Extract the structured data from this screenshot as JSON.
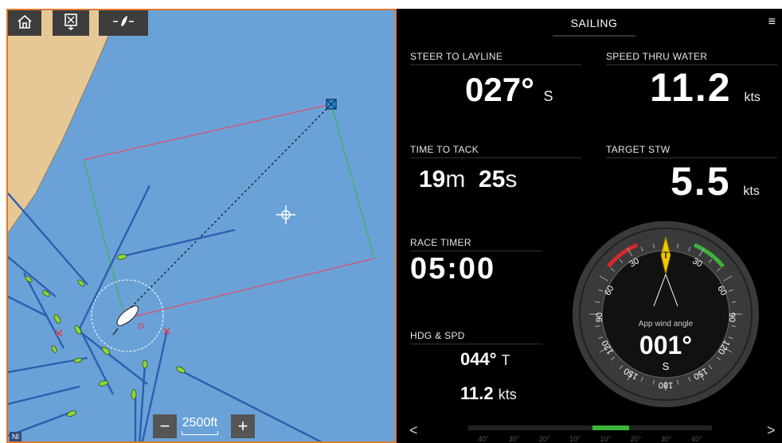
{
  "chart": {
    "scale_label": "2500ft",
    "zoom_out": "−",
    "zoom_in": "+",
    "logo": "NI"
  },
  "header": {
    "title": "SAILING"
  },
  "tiles": {
    "steer_to_layline": {
      "label": "STEER TO LAYLINE",
      "value": "027°",
      "unit": "S"
    },
    "speed_thru_water": {
      "label": "SPEED THRU WATER",
      "value": "11.2",
      "unit": "kts"
    },
    "time_to_tack": {
      "label": "TIME TO TACK",
      "minutes": "19",
      "m_unit": "m",
      "seconds": "25",
      "s_unit": "s"
    },
    "target_stw": {
      "label": "TARGET STW",
      "value": "5.5",
      "unit": "kts"
    },
    "race_timer": {
      "label": "RACE TIMER",
      "value": "05:00"
    },
    "hdg_spd": {
      "label": "HDG & SPD",
      "heading": "044°",
      "heading_unit": "T",
      "speed": "11.2",
      "speed_unit": "kts"
    }
  },
  "wind_gauge": {
    "label": "App wind angle",
    "value": "001°",
    "unit": "S",
    "pointer_label": "T",
    "ticks": [
      "30",
      "30",
      "60",
      "60",
      "90",
      "90",
      "120",
      "120",
      "150",
      "150",
      "180"
    ]
  },
  "wind_bar": {
    "ticks": [
      "40°",
      "30°",
      "20°",
      "10°",
      "10°",
      "20°",
      "30°",
      "40°"
    ]
  },
  "nav": {
    "prev": "<",
    "next": ">"
  },
  "colors": {
    "chart_border": "#e0782c",
    "water": "#6aa2d8",
    "land": "#e6c896",
    "port": "#d42a2a",
    "starboard": "#3cb43c",
    "pointer": "#f0c800"
  }
}
